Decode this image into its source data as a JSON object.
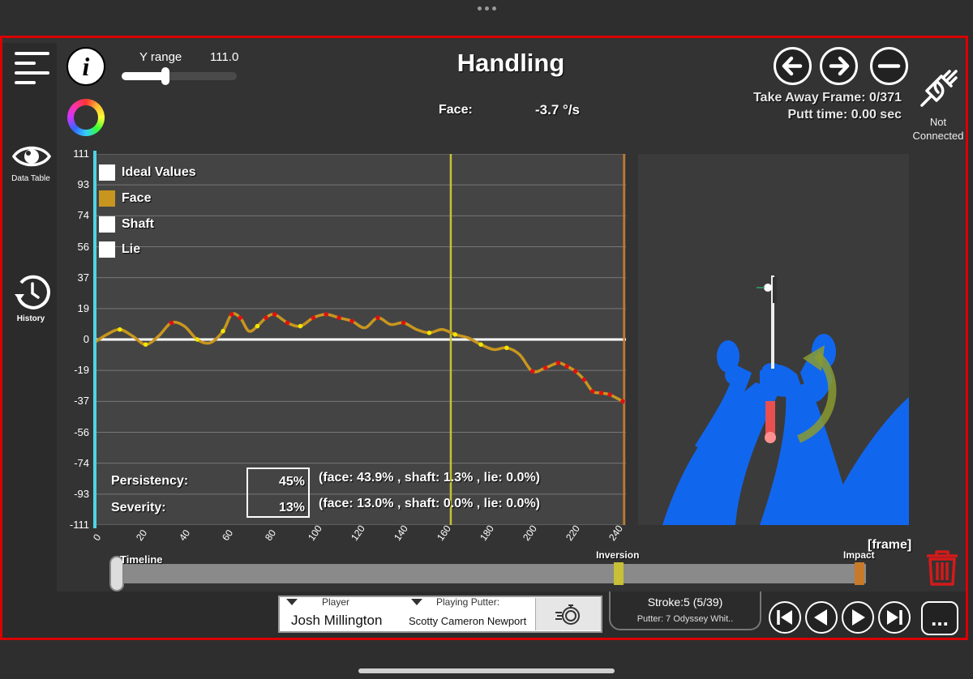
{
  "header": {
    "title": "Handling",
    "y_range_label": "Y range",
    "y_range_value": "111.0",
    "y_range_fraction": 0.38,
    "face_label": "Face:",
    "face_value": "-3.7 °/s",
    "take_away_frame": "Take Away Frame: 0/371",
    "putt_time": "Putt time: 0.00 sec",
    "connection_status_line1": "Not",
    "connection_status_line2": "Connected"
  },
  "sidebar": {
    "data_table_label": "Data Table",
    "history_label": "History"
  },
  "legend": [
    {
      "label": "Ideal Values",
      "color": "#ffffff"
    },
    {
      "label": "Face",
      "color": "#c8961e"
    },
    {
      "label": "Shaft",
      "color": "#ffffff"
    },
    {
      "label": "Lie",
      "color": "#ffffff"
    }
  ],
  "stats": {
    "persistency_label": "Persistency:",
    "persistency_value": "45%",
    "persistency_detail": "(face: 43.9% , shaft: 1.3% , lie: 0.0%)",
    "severity_label": "Severity:",
    "severity_value": "13%",
    "severity_detail": "(face: 13.0% , shaft: 0.0% , lie: 0.0%)"
  },
  "chart_data": {
    "type": "line",
    "xlabel": "[frame]",
    "ylim": [
      -111,
      111
    ],
    "xlim": [
      0,
      246
    ],
    "y_ticks": [
      "111",
      "93",
      "74",
      "56",
      "37",
      "19",
      "0",
      "-19",
      "-37",
      "-56",
      "-74",
      "-93",
      "-111"
    ],
    "x_ticks": [
      "0",
      "20",
      "40",
      "60",
      "80",
      "100",
      "120",
      "140",
      "160",
      "180",
      "200",
      "220",
      "240"
    ],
    "series": [
      {
        "name": "Face",
        "color": "#c8961e",
        "x": [
          0,
          6,
          12,
          18,
          24,
          30,
          36,
          42,
          48,
          54,
          60,
          64,
          68,
          72,
          76,
          80,
          84,
          90,
          96,
          102,
          108,
          114,
          120,
          126,
          132,
          138,
          144,
          150,
          156,
          162,
          168,
          174,
          180,
          186,
          192,
          198,
          204,
          210,
          216,
          220,
          224,
          228,
          232,
          236,
          240,
          246
        ],
        "y": [
          -2,
          3,
          6,
          2,
          -3,
          2,
          10,
          8,
          0,
          -2,
          5,
          15,
          13,
          5,
          8,
          13,
          15,
          10,
          8,
          13,
          15,
          13,
          11,
          7,
          13,
          9,
          10,
          6,
          4,
          6,
          3,
          1,
          -3,
          -6,
          -5,
          -9,
          -19,
          -17,
          -14,
          -16,
          -19,
          -24,
          -31,
          -32,
          -33,
          -37
        ]
      }
    ],
    "ideal_value": 0,
    "inversion_frame": 166,
    "impact_frame": 247
  },
  "timeline": {
    "label": "Timeline",
    "inversion_label": "Inversion",
    "impact_label": "Impact",
    "inversion_fraction": 0.67,
    "impact_fraction": 1.0
  },
  "footer": {
    "player_label": "Player",
    "player_name": "Josh Millington",
    "putter_label": "Playing Putter:",
    "putter_name": "Scotty Cameron Newport",
    "stroke": "Stroke:5 (5/39)",
    "putter_detail": "Putter: 7 Odyssey Whit..",
    "more_label": "..."
  },
  "colors": {
    "frame_border": "#d90000",
    "accent_cyan": "#4fd4e6",
    "face_line": "#c8961e",
    "highlight_yellow": "#f2e600",
    "highlight_red": "#e01010",
    "inversion_line": "#c8c036",
    "impact_line": "#c87a2a",
    "body_blue": "#1166ee",
    "trash_red": "#d41a1a"
  }
}
